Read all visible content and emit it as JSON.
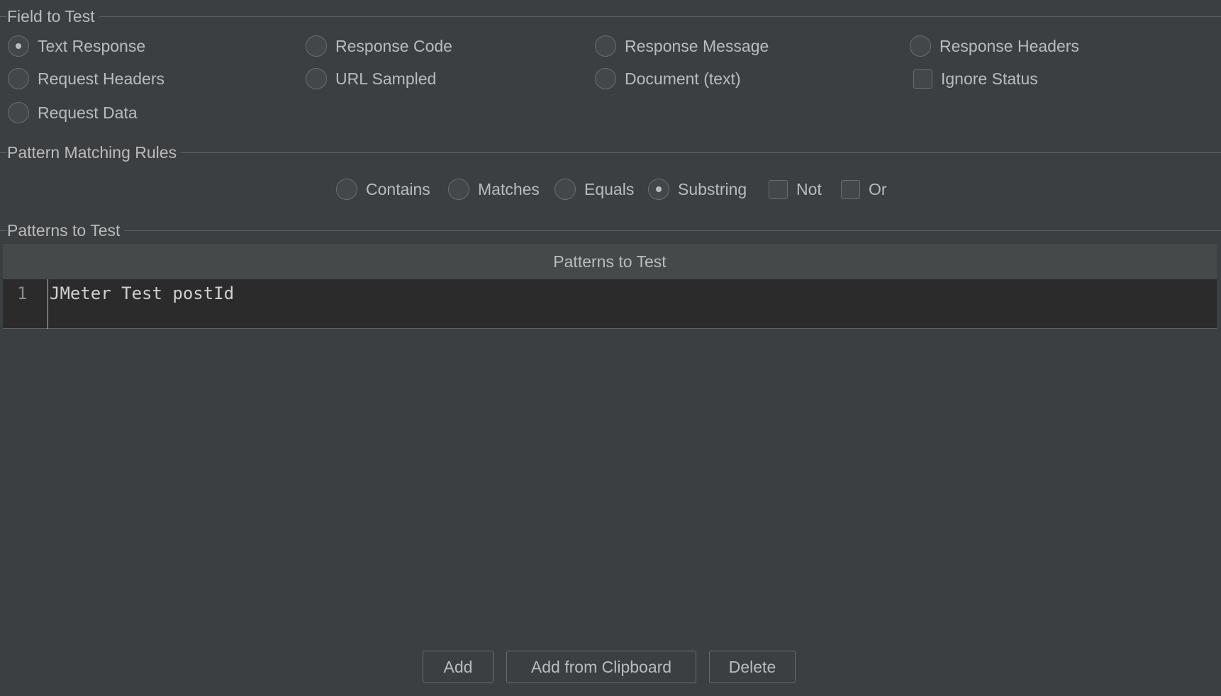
{
  "field_to_test": {
    "title": "Field to Test",
    "options": {
      "text_response": "Text Response",
      "response_code": "Response Code",
      "response_message": "Response Message",
      "response_headers": "Response Headers",
      "request_headers": "Request Headers",
      "url_sampled": "URL Sampled",
      "document_text": "Document (text)",
      "ignore_status": "Ignore Status",
      "request_data": "Request Data"
    },
    "selected": "Text Response",
    "ignore_status_checked": false
  },
  "pattern_matching_rules": {
    "title": "Pattern Matching Rules",
    "options": {
      "contains": "Contains",
      "matches": "Matches",
      "equals": "Equals",
      "substring": "Substring",
      "not": "Not",
      "or": "Or"
    },
    "selected": "Substring",
    "not_checked": false,
    "or_checked": false
  },
  "patterns_to_test": {
    "title": "Patterns to Test",
    "table": {
      "column_header": "Patterns to Test",
      "rows": [
        {
          "line": "1",
          "value": "JMeter Test postId"
        }
      ]
    }
  },
  "buttons": {
    "add": "Add",
    "add_from_clipboard": "Add from Clipboard",
    "delete": "Delete"
  }
}
